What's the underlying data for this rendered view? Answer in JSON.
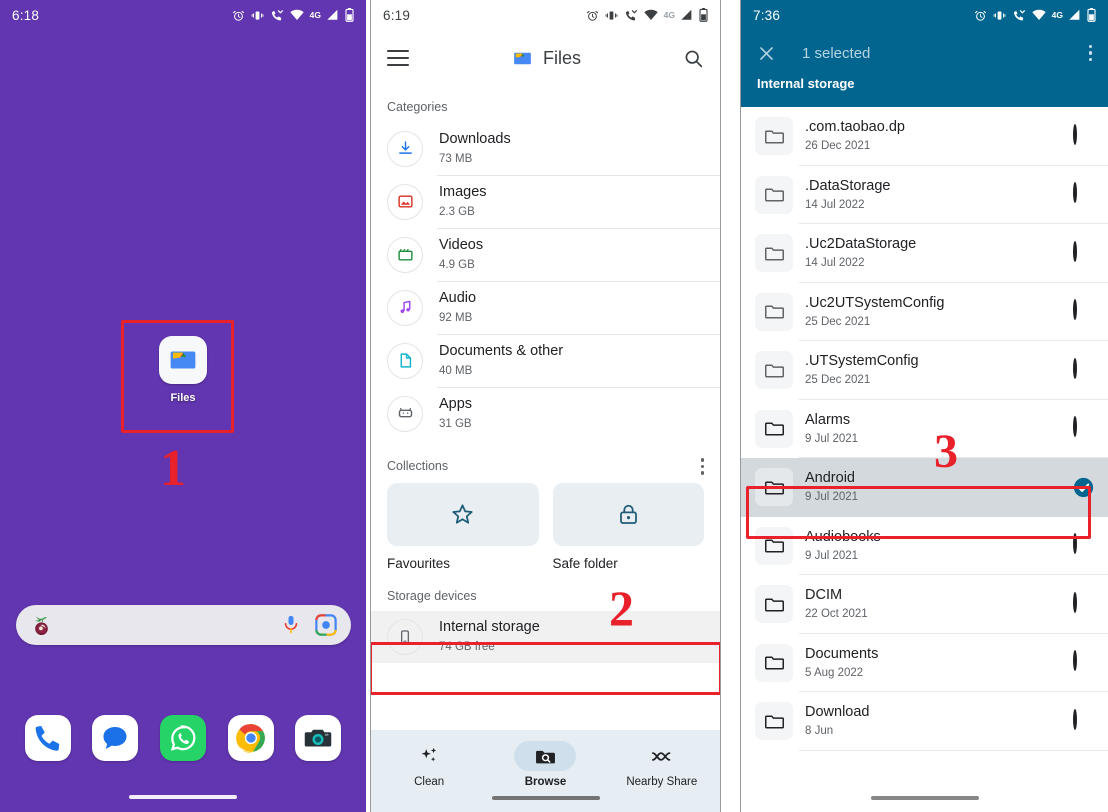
{
  "panel1": {
    "status": {
      "time": "6:18",
      "network": "4G",
      "icons": [
        "alarm-icon",
        "vibrate-icon",
        "call-wifi-icon",
        "wifi-icon",
        "signal-icon",
        "battery-icon"
      ]
    },
    "app_icon": {
      "label": "Files",
      "icon": "files-app-icon"
    },
    "search": {
      "assistant_icon": "fruit-logo-icon",
      "mic_icon": "microphone-icon",
      "lens_icon": "google-lens-icon",
      "placeholder": ""
    },
    "dock": [
      {
        "name": "phone",
        "icon": "phone-icon"
      },
      {
        "name": "messages",
        "icon": "messages-icon"
      },
      {
        "name": "whatsapp",
        "icon": "whatsapp-icon"
      },
      {
        "name": "chrome",
        "icon": "chrome-icon"
      },
      {
        "name": "camera",
        "icon": "camera-icon"
      }
    ],
    "annotation": {
      "step": "1"
    }
  },
  "panel2": {
    "status": {
      "time": "6:19",
      "network": "4G"
    },
    "appbar": {
      "menu_icon": "hamburger-menu-icon",
      "logo": "files-app-icon",
      "title": "Files",
      "search_icon": "search-icon"
    },
    "categories_header": "Categories",
    "categories": [
      {
        "title": "Downloads",
        "size": "73 MB",
        "icon": "download-icon",
        "color": "#1a73e8"
      },
      {
        "title": "Images",
        "size": "2.3 GB",
        "icon": "image-icon",
        "color": "#d93025"
      },
      {
        "title": "Videos",
        "size": "4.9 GB",
        "icon": "video-icon",
        "color": "#1e8e3e"
      },
      {
        "title": "Audio",
        "size": "92 MB",
        "icon": "music-note-icon",
        "color": "#a142f4"
      },
      {
        "title": "Documents & other",
        "size": "40 MB",
        "icon": "document-icon",
        "color": "#12b5cb"
      },
      {
        "title": "Apps",
        "size": "31 GB",
        "icon": "android-apps-icon",
        "color": "#5f6368"
      }
    ],
    "collections_header": "Collections",
    "collections_menu_icon": "overflow-menu-icon",
    "collections": [
      {
        "label": "Favourites",
        "icon": "star-icon"
      },
      {
        "label": "Safe folder",
        "icon": "lock-icon"
      }
    ],
    "storage_header": "Storage devices",
    "storage": {
      "title": "Internal storage",
      "subtitle": "74 GB free",
      "icon": "phone-storage-icon"
    },
    "bottom_nav": [
      {
        "label": "Clean",
        "icon": "sparkle-icon",
        "active": false
      },
      {
        "label": "Browse",
        "icon": "folder-search-icon",
        "active": true
      },
      {
        "label": "Nearby Share",
        "icon": "nearby-share-icon",
        "active": false
      }
    ],
    "annotation": {
      "step": "2"
    }
  },
  "panel3": {
    "status": {
      "time": "7:36",
      "network": "4G"
    },
    "appbar": {
      "close_icon": "close-icon",
      "selected_text": "1 selected",
      "menu_icon": "overflow-menu-icon",
      "path": "Internal storage"
    },
    "files": [
      {
        "name": ".com.taobao.dp",
        "date": "26 Dec 2021",
        "selected": false
      },
      {
        "name": ".DataStorage",
        "date": "14 Jul 2022",
        "selected": false
      },
      {
        "name": ".Uc2DataStorage",
        "date": "14 Jul 2022",
        "selected": false
      },
      {
        "name": ".Uc2UTSystemConfig",
        "date": "25 Dec 2021",
        "selected": false
      },
      {
        "name": ".UTSystemConfig",
        "date": "25 Dec 2021",
        "selected": false
      },
      {
        "name": "Alarms",
        "date": "9 Jul 2021",
        "selected": false
      },
      {
        "name": "Android",
        "date": "9 Jul 2021",
        "selected": true
      },
      {
        "name": "Audiobooks",
        "date": "9 Jul 2021",
        "selected": false
      },
      {
        "name": "DCIM",
        "date": "22 Oct 2021",
        "selected": false
      },
      {
        "name": "Documents",
        "date": "5 Aug 2022",
        "selected": false
      },
      {
        "name": "Download",
        "date": "8 Jun",
        "selected": false
      }
    ],
    "annotation": {
      "step": "3"
    }
  },
  "colors": {
    "wallpaper_purple": "#6236b0",
    "selection_teal": "#01658f",
    "annotation_red": "#e8212b",
    "selected_row_grey": "#d3d9dd"
  }
}
